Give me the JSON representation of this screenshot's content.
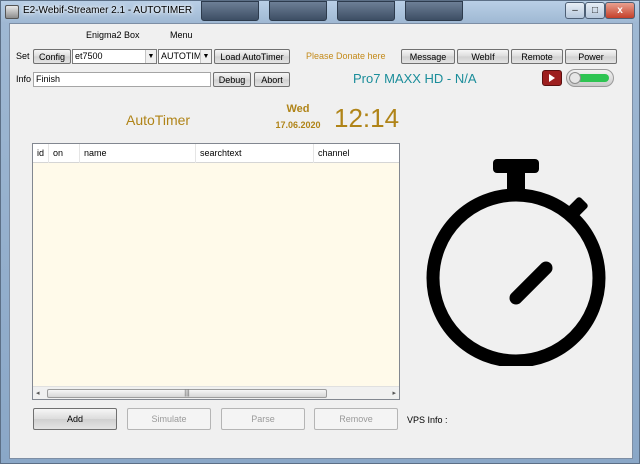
{
  "window": {
    "title": "E2-Webif-Streamer 2.1 - AUTOTIMER",
    "minimize_glyph": "–",
    "maximize_glyph": "□",
    "close_glyph": "x"
  },
  "top_labels": {
    "enigma_box": "Enigma2 Box",
    "menu": "Menu"
  },
  "row_set": {
    "label": "Set",
    "config_button": "Config",
    "box_select": "et7500",
    "menu_select": "AUTOTIMER",
    "load_button": "Load AutoTimer",
    "donate_text": "Please Donate here",
    "message_button": "Message",
    "webif_button": "WebIf",
    "remote_button": "Remote",
    "power_button": "Power"
  },
  "row_info": {
    "label": "Info",
    "info_value": "Finish",
    "debug_button": "Debug",
    "abort_button": "Abort",
    "channel_name": "Pro7 MAXX HD - N/A",
    "toggle_on": true
  },
  "autotimer": {
    "title": "AutoTimer",
    "day": "Wed",
    "date": "17.06.2020",
    "time": "12:14"
  },
  "list": {
    "columns": [
      "id",
      "on",
      "name",
      "searchtext",
      "channel"
    ],
    "rows": [],
    "scroll_thumb_glyph": "|||"
  },
  "bottom": {
    "add_button": "Add",
    "simulate_button": "Simulate",
    "parse_button": "Parse",
    "remove_button": "Remove",
    "vps_label": "VPS Info :"
  },
  "colors": {
    "accent_gold": "#b08418",
    "channel_teal": "#1a8d9a",
    "list_background": "#fffaea",
    "toggle_green": "#2ec452"
  },
  "icons": [
    "window-icon",
    "play-icon",
    "stopwatch-icon"
  ]
}
